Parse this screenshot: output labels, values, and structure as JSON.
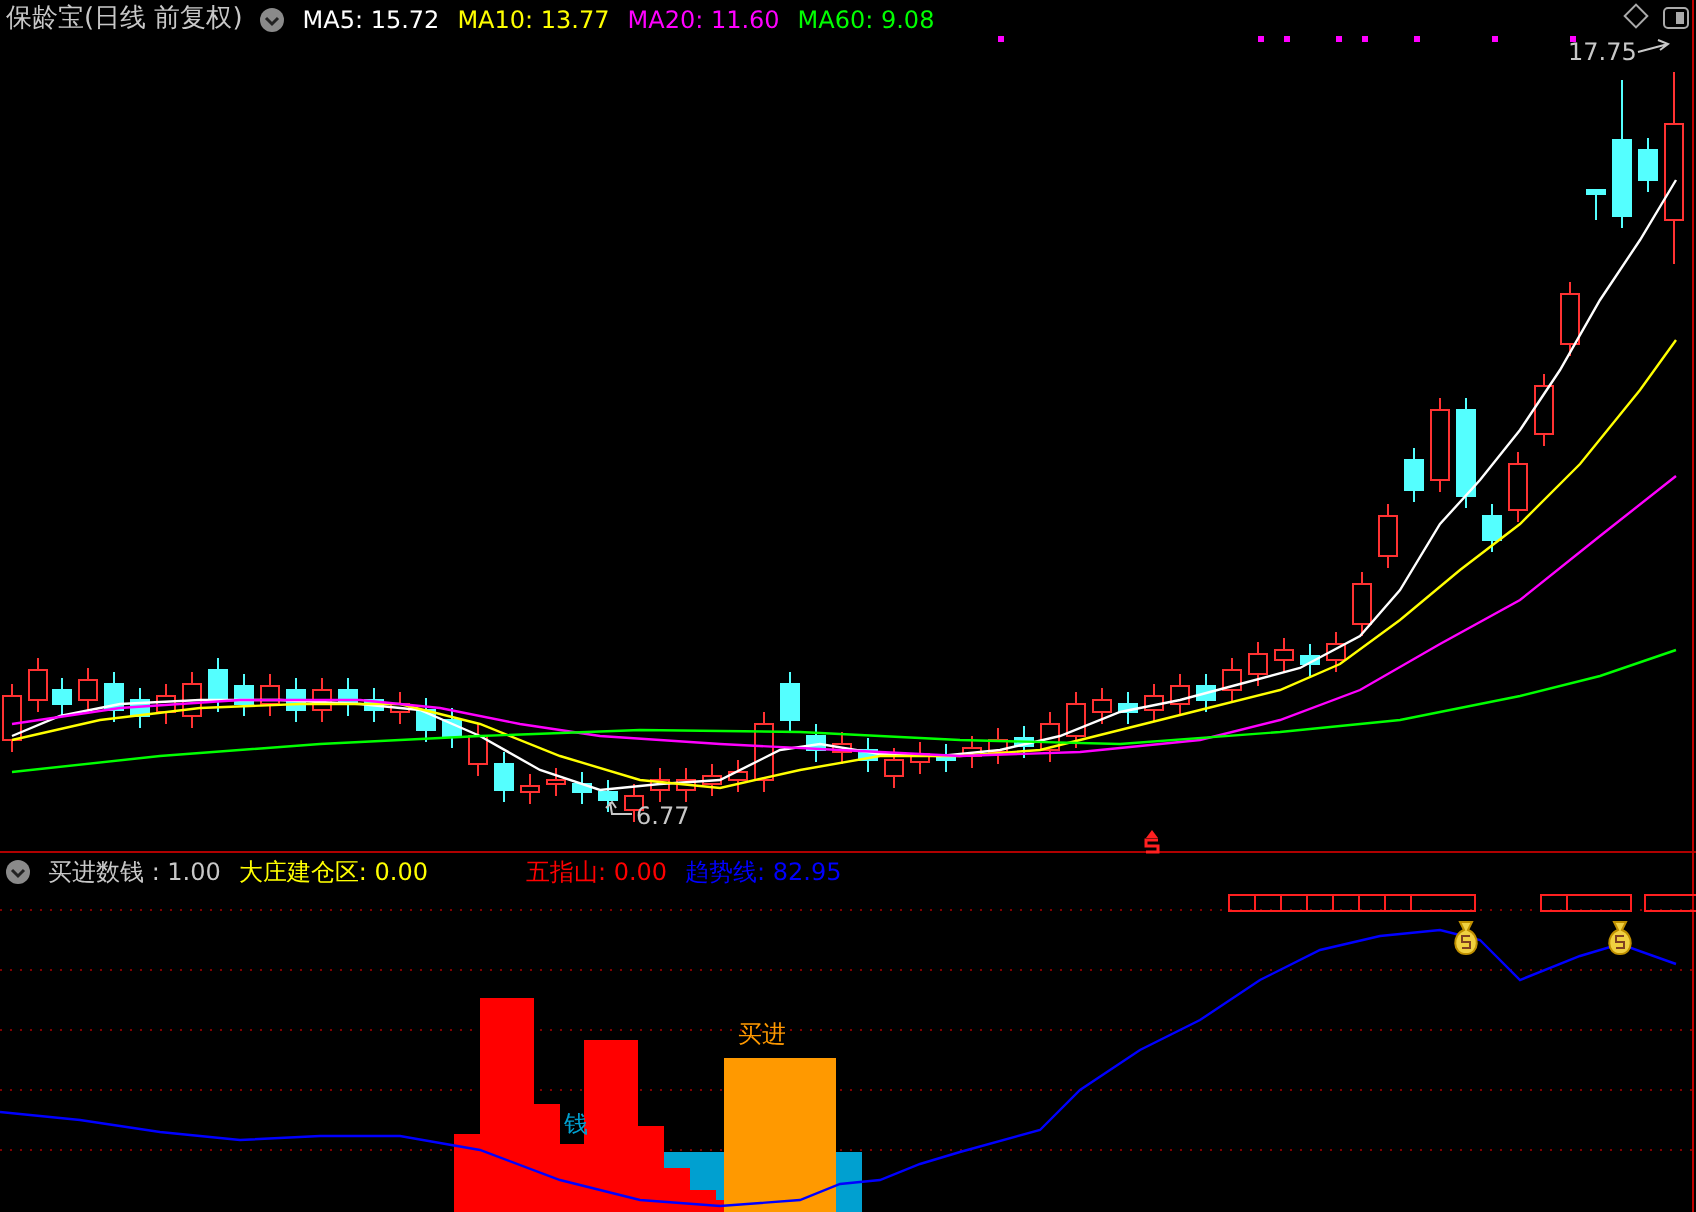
{
  "main_panel": {
    "title": "保龄宝(日线 前复权)",
    "indicators": [
      {
        "label": "MA5: 15.72",
        "color": "#ffffff"
      },
      {
        "label": "MA10: 13.77",
        "color": "#ffff00"
      },
      {
        "label": "MA20: 11.60",
        "color": "#ff00ff"
      },
      {
        "label": "MA60: 9.08",
        "color": "#00ff00"
      }
    ],
    "high_label": "17.75",
    "low_label": "6.77"
  },
  "sub_panel": {
    "indicators": [
      {
        "label": "买进数钱 : 1.00",
        "color": "#c8c8c8"
      },
      {
        "label": "大庄建仓区: 0.00",
        "color": "#ffff00"
      },
      {
        "label": "五指山: 0.00",
        "color": "#ff0000"
      },
      {
        "label": "趋势线: 82.95",
        "color": "#0000ff"
      }
    ],
    "bar_labels": [
      {
        "text": "买进",
        "color": "#ff9900"
      },
      {
        "text": "钱",
        "color": "#00a0d0"
      }
    ]
  }
}
